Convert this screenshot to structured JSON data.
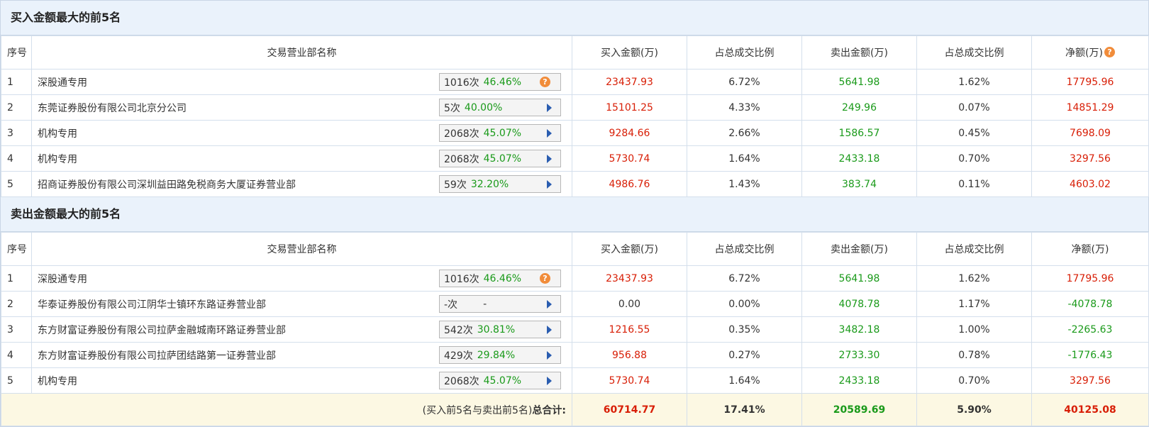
{
  "buy_section": {
    "title": "买入金额最大的前5名",
    "headers": {
      "seq": "序号",
      "name": "交易营业部名称",
      "buy": "买入金额(万)",
      "buy_ratio": "占总成交比例",
      "sell": "卖出金额(万)",
      "sell_ratio": "占总成交比例",
      "net": "净额(万)",
      "net_help_icon": "?"
    },
    "rows": [
      {
        "seq": "1",
        "name": "深股通专用",
        "count": "1016次",
        "pct": "46.46%",
        "icon": "?",
        "buy": "23437.93",
        "buy_ratio": "6.72%",
        "sell": "5641.98",
        "sell_ratio": "1.62%",
        "net": "17795.96"
      },
      {
        "seq": "2",
        "name": "东莞证券股份有限公司北京分公司",
        "count": "5次",
        "pct": "40.00%",
        "buy": "15101.25",
        "buy_ratio": "4.33%",
        "sell": "249.96",
        "sell_ratio": "0.07%",
        "net": "14851.29"
      },
      {
        "seq": "3",
        "name": "机构专用",
        "count": "2068次",
        "pct": "45.07%",
        "buy": "9284.66",
        "buy_ratio": "2.66%",
        "sell": "1586.57",
        "sell_ratio": "0.45%",
        "net": "7698.09"
      },
      {
        "seq": "4",
        "name": "机构专用",
        "count": "2068次",
        "pct": "45.07%",
        "buy": "5730.74",
        "buy_ratio": "1.64%",
        "sell": "2433.18",
        "sell_ratio": "0.70%",
        "net": "3297.56"
      },
      {
        "seq": "5",
        "name": "招商证券股份有限公司深圳益田路免税商务大厦证券营业部",
        "count": "59次",
        "pct": "32.20%",
        "buy": "4986.76",
        "buy_ratio": "1.43%",
        "sell": "383.74",
        "sell_ratio": "0.11%",
        "net": "4603.02"
      }
    ]
  },
  "sell_section": {
    "title": "卖出金额最大的前5名",
    "headers": {
      "seq": "序号",
      "name": "交易营业部名称",
      "buy": "买入金额(万)",
      "buy_ratio": "占总成交比例",
      "sell": "卖出金额(万)",
      "sell_ratio": "占总成交比例",
      "net": "净额(万)"
    },
    "rows": [
      {
        "seq": "1",
        "name": "深股通专用",
        "count": "1016次",
        "pct": "46.46%",
        "icon": "?",
        "buy": "23437.93",
        "buy_ratio": "6.72%",
        "sell": "5641.98",
        "sell_ratio": "1.62%",
        "net": "17795.96"
      },
      {
        "seq": "2",
        "name": "华泰证券股份有限公司江阴华士镇环东路证券营业部",
        "count": "-次",
        "pct": "-",
        "buy": "0.00",
        "buy_ratio": "0.00%",
        "sell": "4078.78",
        "sell_ratio": "1.17%",
        "net": "-4078.78"
      },
      {
        "seq": "3",
        "name": "东方财富证券股份有限公司拉萨金融城南环路证券营业部",
        "count": "542次",
        "pct": "30.81%",
        "buy": "1216.55",
        "buy_ratio": "0.35%",
        "sell": "3482.18",
        "sell_ratio": "1.00%",
        "net": "-2265.63"
      },
      {
        "seq": "4",
        "name": "东方财富证券股份有限公司拉萨团结路第一证券营业部",
        "count": "429次",
        "pct": "29.84%",
        "buy": "956.88",
        "buy_ratio": "0.27%",
        "sell": "2733.30",
        "sell_ratio": "0.78%",
        "net": "-1776.43"
      },
      {
        "seq": "5",
        "name": "机构专用",
        "count": "2068次",
        "pct": "45.07%",
        "buy": "5730.74",
        "buy_ratio": "1.64%",
        "sell": "2433.18",
        "sell_ratio": "0.70%",
        "net": "3297.56"
      }
    ]
  },
  "total": {
    "label_prefix": "(买入前5名与卖出前5名)",
    "label_bold": "总合计:",
    "buy": "60714.77",
    "buy_ratio": "17.41%",
    "sell": "20589.69",
    "sell_ratio": "5.90%",
    "net": "40125.08"
  },
  "colors": {
    "buy": "#d81e06",
    "sell": "#1a9a1a",
    "header_bg": "#eaf2fb",
    "total_bg": "#fcf8e3"
  }
}
